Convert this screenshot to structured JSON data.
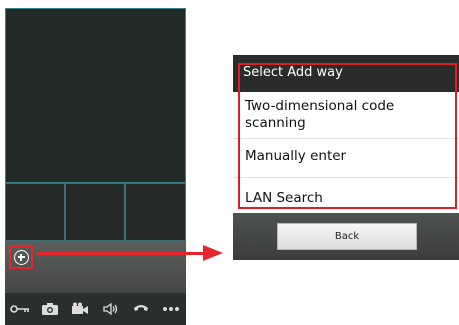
{
  "dialog": {
    "title": "Select Add way",
    "options": [
      "Two-dimensional code scanning",
      "Manually enter",
      "LAN Search"
    ],
    "back_label": "Back"
  },
  "toolbar": {
    "icons": [
      "key-icon",
      "camera-icon",
      "video-record-icon",
      "speaker-icon",
      "hangup-icon",
      "more-icon"
    ]
  },
  "colors": {
    "highlight": "#d92027",
    "video_border": "#3c7f8c",
    "dark_bg": "#1f2724"
  }
}
